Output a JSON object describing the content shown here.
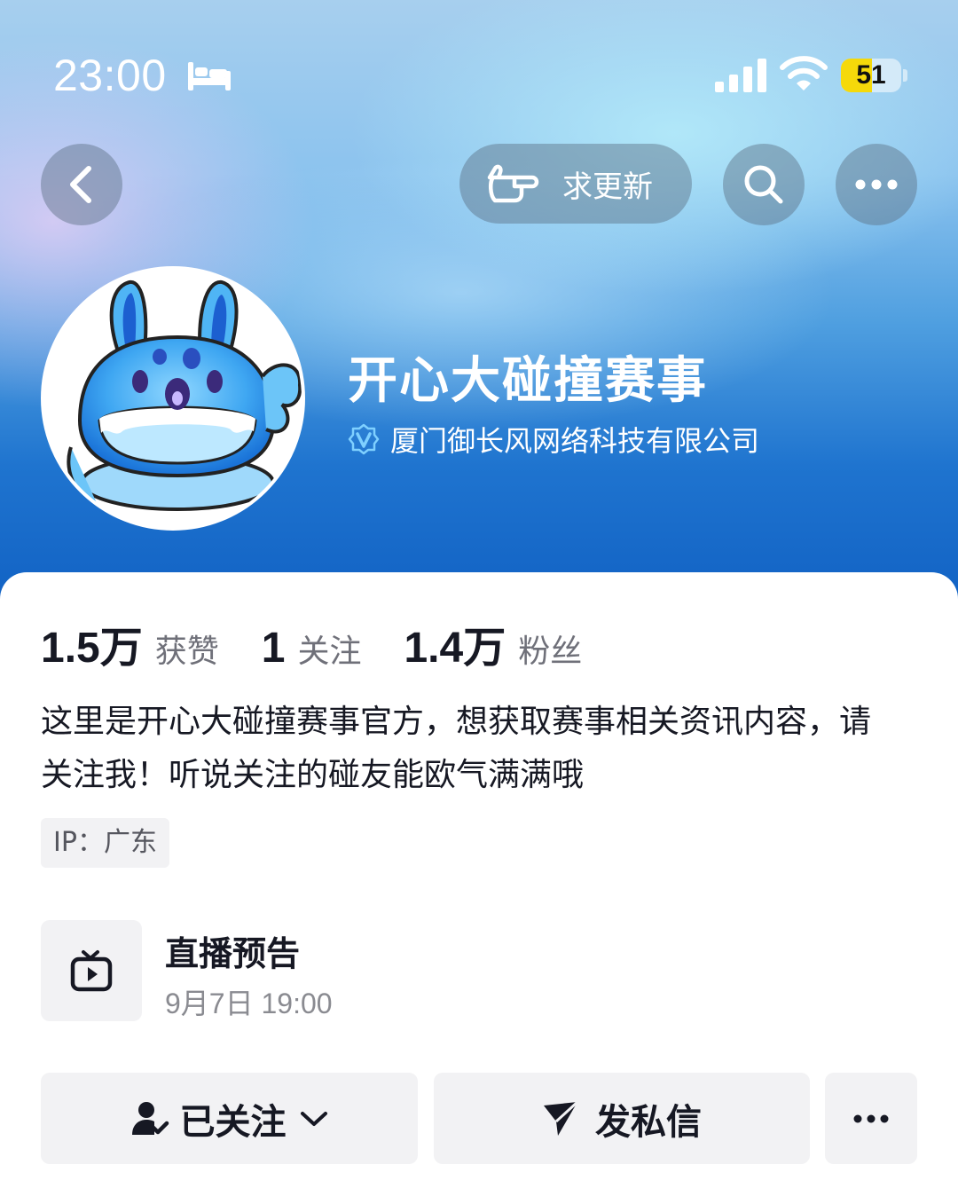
{
  "status_bar": {
    "time": "23:00",
    "battery_level": "51",
    "battery_fraction": 0.51,
    "battery_color": "#f5d90a",
    "icons": [
      "bed-icon",
      "signal-icon",
      "wifi-icon",
      "battery-icon"
    ]
  },
  "nav": {
    "back_icon": "chevron-left-icon",
    "request_update_label": "求更新",
    "request_update_icon": "pointing-hand-icon",
    "search_icon": "search-icon",
    "more_icon": "more-dots-icon"
  },
  "profile": {
    "name": "开心大碰撞赛事",
    "verified_org": "厦门御长风网络科技有限公司",
    "verified_icon": "verified-badge-icon"
  },
  "stats": [
    {
      "value": "1.5万",
      "label": "获赞"
    },
    {
      "value": "1",
      "label": "关注"
    },
    {
      "value": "1.4万",
      "label": "粉丝"
    }
  ],
  "bio": "这里是开心大碰撞赛事官方，想获取赛事相关资讯内容，请关注我！听说关注的碰友能欧气满满哦",
  "ip_location": "IP：广东",
  "live_preview": {
    "icon": "tv-play-icon",
    "title": "直播预告",
    "time": "9月7日 19:00"
  },
  "actions": {
    "follow_label": "已关注",
    "follow_icon": "user-check-icon",
    "message_label": "发私信",
    "message_icon": "send-icon",
    "more_icon": "more-dots-icon"
  },
  "colors": {
    "header_top": "#a7cfee",
    "header_bottom": "#1060c3",
    "button_bg": "#f2f2f4",
    "text_primary": "#161823",
    "text_secondary": "#6f7079"
  }
}
